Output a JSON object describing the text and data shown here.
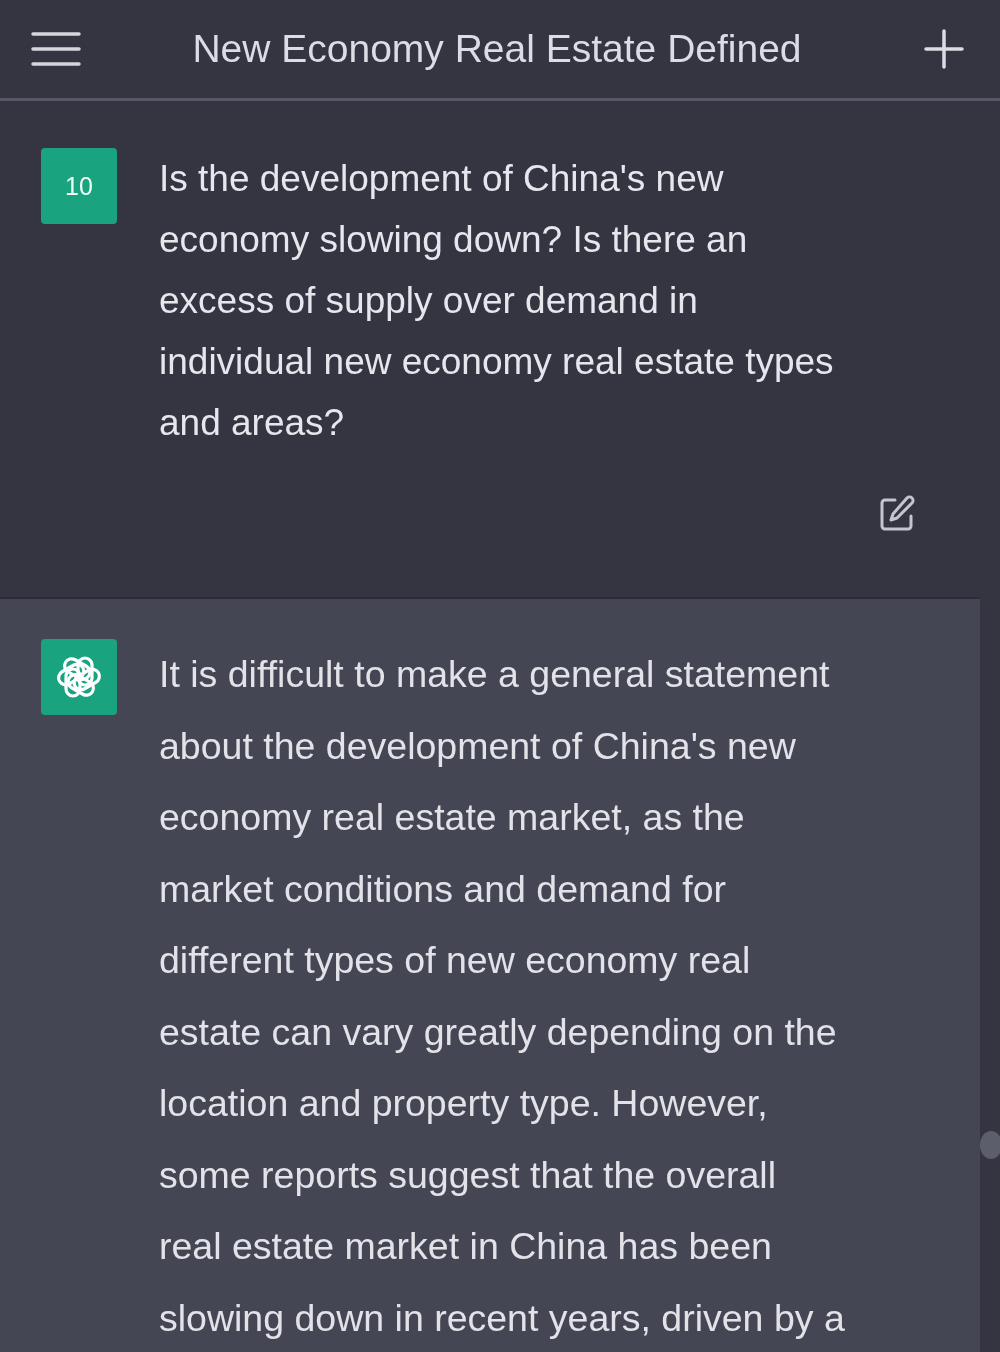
{
  "header": {
    "title": "New Economy Real Estate Defined"
  },
  "messages": [
    {
      "kind": "user",
      "avatar_text": "10",
      "lines": [
        "Is the development of China's new",
        "economy slowing down? Is there an",
        "excess of supply over demand in",
        "individual new economy real estate types",
        "and areas?"
      ]
    },
    {
      "kind": "assistant",
      "lines": [
        "It is difficult to make a general statement",
        "about the development of China's new",
        "economy real estate market, as the",
        "market conditions and demand for",
        "different types of new economy real",
        "estate can vary greatly depending on the",
        "location and property type. However,",
        "some reports suggest that the overall",
        "real estate market in China has been",
        "slowing down in recent years, driven by a"
      ]
    }
  ]
}
